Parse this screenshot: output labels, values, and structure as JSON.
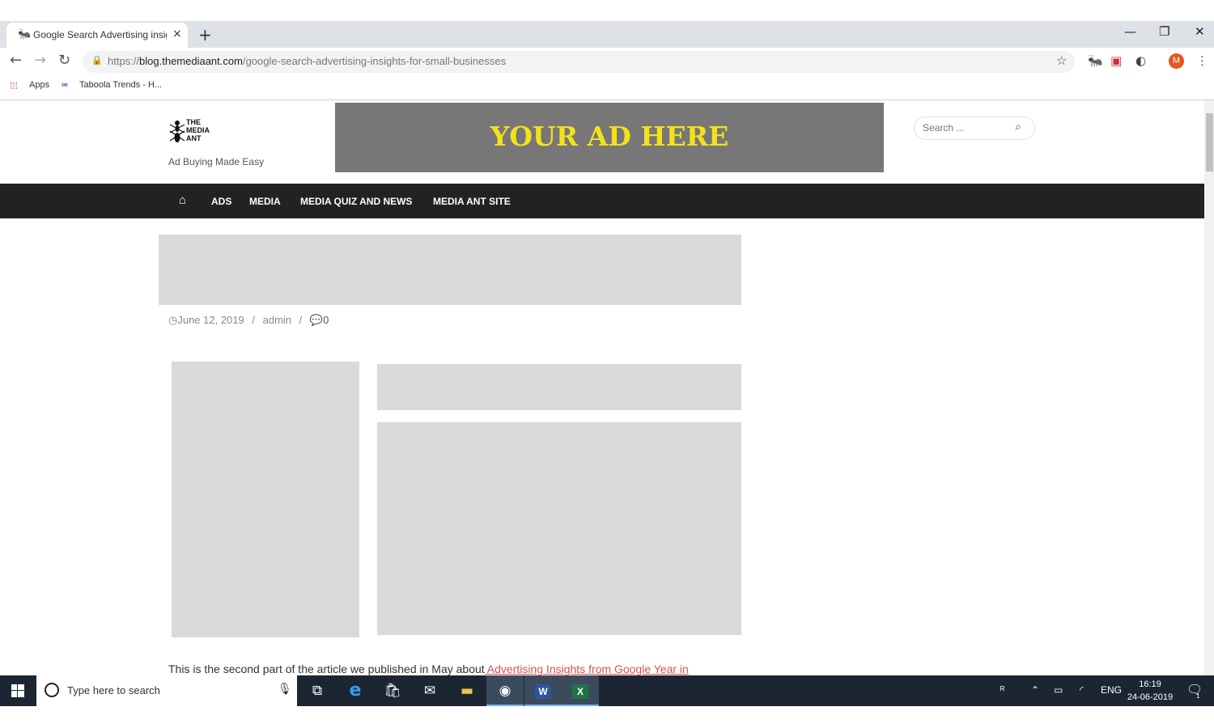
{
  "browser": {
    "tab_title": "Google Search Advertising insigh",
    "new_tab": "+",
    "tab_close": "×",
    "url_prefix": "https://",
    "url_host": "blog.themediaant.com",
    "url_path": "/google-search-advertising-insights-for-small-businesses",
    "bookmarks": [
      {
        "label": "Apps"
      },
      {
        "label": "Taboola Trends - H..."
      }
    ],
    "profile_initial": "M"
  },
  "site": {
    "logo_lines": [
      "THE",
      "MEDIA",
      "ANT"
    ],
    "tagline": "Ad Buying Made Easy",
    "ad_banner_text": "YOUR AD HERE",
    "search_placeholder": "Search ...",
    "nav": [
      {
        "label": "ADS"
      },
      {
        "label": "MEDIA"
      },
      {
        "label": "MEDIA QUIZ AND NEWS"
      },
      {
        "label": "MEDIA ANT SITE"
      }
    ],
    "meta": {
      "date": "June 12, 2019",
      "separator": "/",
      "author": "admin",
      "comments": "0"
    },
    "body": {
      "text": "This is the second part of the article we published in May about",
      "link": " Advertising Insights from Google Year in"
    }
  },
  "taskbar": {
    "search_placeholder": "Type here to search",
    "language": "ENG",
    "time": "16:19",
    "date": "24-06-2019",
    "notification_count": "1"
  },
  "colors": {
    "ad_banner_bg": "#777777",
    "ad_banner_text": "#f5e11a",
    "navbar_bg": "#222222",
    "link": "#d9534f",
    "taskbar_bg": "#1c2632"
  }
}
